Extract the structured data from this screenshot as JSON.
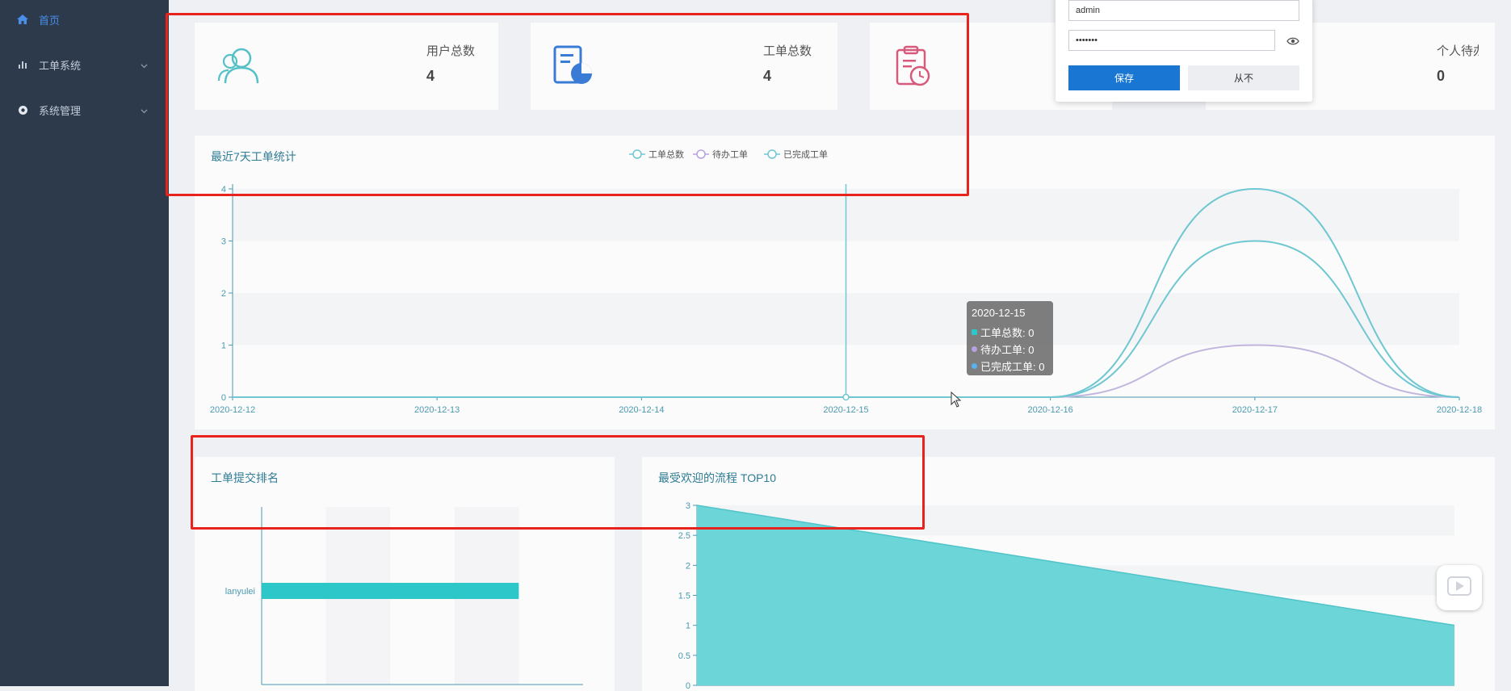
{
  "sidebar": {
    "items": [
      {
        "label": "首页",
        "icon": "home-icon"
      },
      {
        "label": "工单系统",
        "icon": "chart-icon"
      },
      {
        "label": "系统管理",
        "icon": "settings-icon"
      }
    ]
  },
  "stats": [
    {
      "label": "用户总数",
      "value": "4",
      "icon": "users-icon",
      "color": "#55c1c7"
    },
    {
      "label": "工单总数",
      "value": "4",
      "icon": "order-report-icon",
      "color": "#3a7bd5"
    },
    {
      "label": "",
      "value": "",
      "icon": "clipboard-clock-icon",
      "color": "#d85a7a"
    },
    {
      "label": "个人待办",
      "value": "0"
    }
  ],
  "login_popup": {
    "username": "admin",
    "password": "•••••••",
    "save_label": "保存",
    "never_label": "从不"
  },
  "tooltip": {
    "date": "2020-12-15",
    "rows": [
      {
        "label": "工单总数: 0",
        "color": "#2ec7c9"
      },
      {
        "label": "待办工单: 0",
        "color": "#b6a2de"
      },
      {
        "label": "已完成工单: 0",
        "color": "#5ab1ef"
      }
    ]
  },
  "chart_data": [
    {
      "type": "line",
      "title": "最近7天工单统计",
      "x": [
        "2020-12-12",
        "2020-12-13",
        "2020-12-14",
        "2020-12-15",
        "2020-12-16",
        "2020-12-17",
        "2020-12-18"
      ],
      "ylim": [
        0,
        4
      ],
      "yticks": [
        0,
        1,
        2,
        3,
        4
      ],
      "smooth": true,
      "legend_position": "top-right",
      "series": [
        {
          "name": "工单总数",
          "values": [
            0,
            0,
            0,
            0,
            0,
            4,
            0
          ],
          "color": "#6fc7d1"
        },
        {
          "name": "待办工单",
          "values": [
            0,
            0,
            0,
            0,
            0,
            1,
            0
          ],
          "color": "#c2b6dd"
        },
        {
          "name": "已完成工单",
          "values": [
            0,
            0,
            0,
            0,
            0,
            3,
            0
          ],
          "color": "#6fc7d1"
        }
      ]
    },
    {
      "type": "bar",
      "orientation": "horizontal",
      "title": "工单提交排名",
      "categories": [
        "lanyulei"
      ],
      "values": [
        4
      ],
      "xlim": [
        0,
        5
      ],
      "color": "#2ec7c9"
    },
    {
      "type": "area",
      "title": "最受欢迎的流程 TOP10",
      "x": [
        0,
        1
      ],
      "values": [
        3,
        1
      ],
      "ylim": [
        0,
        3
      ],
      "yticks": [
        "0",
        "0.5",
        "1",
        "1.5",
        "2",
        "2.5",
        "3"
      ],
      "color": "#6cd5d8"
    }
  ]
}
